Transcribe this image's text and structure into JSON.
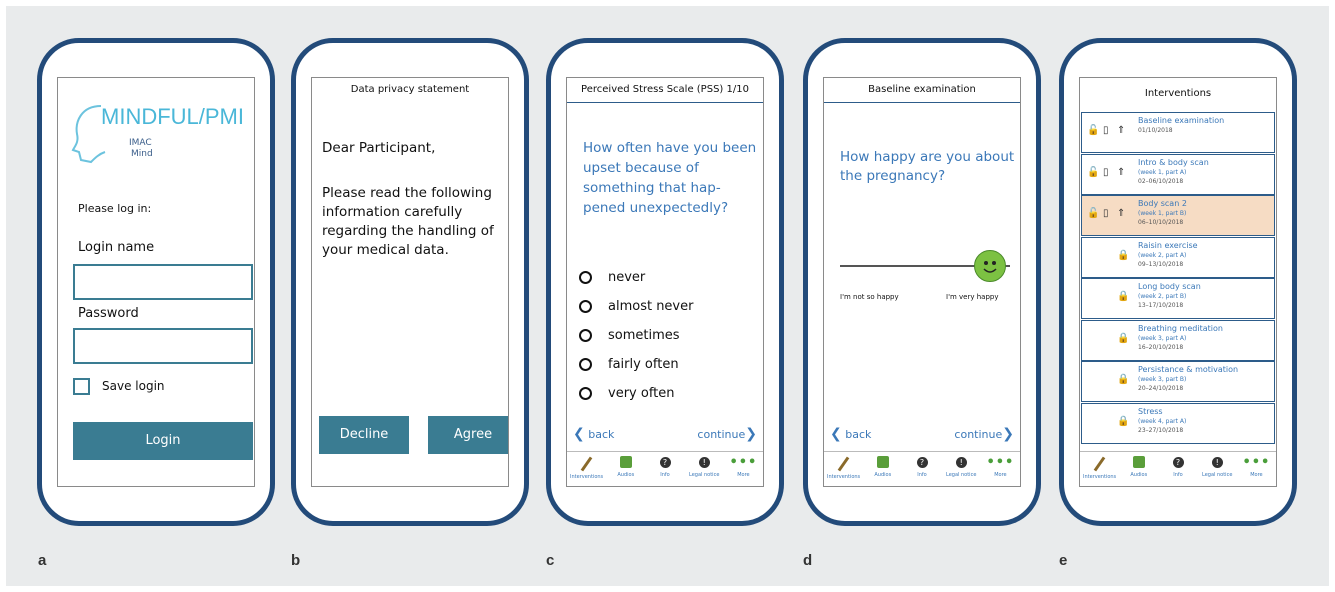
{
  "labels": [
    "a",
    "b",
    "c",
    "d",
    "e"
  ],
  "a": {
    "logo_text": "MINDFUL/PMI",
    "logo_sub1": "IMAC",
    "logo_sub2": "Mind",
    "please_login": "Please log in:",
    "login_name_label": "Login name",
    "password_label": "Password",
    "save_login": "Save login",
    "login_button": "Login"
  },
  "b": {
    "title": "Data privacy statement",
    "greeting": "Dear Participant,",
    "body": "Please read the following information carefully regarding the handling of your medical data.",
    "decline": "Decline",
    "agree": "Agree"
  },
  "c": {
    "title": "Perceived Stress Scale (PSS) 1/10",
    "question": "How often have you been upset because of something that hap-pened unexpectedly?",
    "options": [
      "never",
      "almost never",
      "sometimes",
      "fairly often",
      "very often"
    ],
    "back": "back",
    "continue": "continue"
  },
  "d": {
    "title": "Baseline examination",
    "question": "How happy are you about the pregnancy?",
    "low_label": "I'm not so happy",
    "high_label": "I'm very happy",
    "back": "back",
    "continue": "continue"
  },
  "e": {
    "title": "Interventions",
    "items": [
      {
        "name": "Baseline examination",
        "sub": "",
        "dates": "01/10/2018"
      },
      {
        "name": "Intro & body scan",
        "sub": "(week 1, part A)",
        "dates": "02–06/10/2018"
      },
      {
        "name": "Body scan 2",
        "sub": "(week 1, part B)",
        "dates": "06–10/10/2018"
      },
      {
        "name": "Raisin exercise",
        "sub": "(week 2, part A)",
        "dates": "09–13/10/2018"
      },
      {
        "name": "Long body scan",
        "sub": "(week 2, part B)",
        "dates": "13–17/10/2018"
      },
      {
        "name": "Breathing meditation",
        "sub": "(week 3, part A)",
        "dates": "16–20/10/2018"
      },
      {
        "name": "Persistance & motivation",
        "sub": "(week 3, part B)",
        "dates": "20–24/10/2018"
      },
      {
        "name": "Stress",
        "sub": "(week 4, part A)",
        "dates": "23–27/10/2018"
      }
    ]
  },
  "nav": {
    "interventions": "Interventions",
    "audios": "Audios",
    "info": "Info",
    "legal": "Legal notice",
    "more": "More"
  },
  "colors": {
    "frame": "#234b7a",
    "button": "#3a7c92",
    "text_blue": "#3b78b8",
    "highlight": "#f6dcc4",
    "smiley": "#7cc142"
  }
}
